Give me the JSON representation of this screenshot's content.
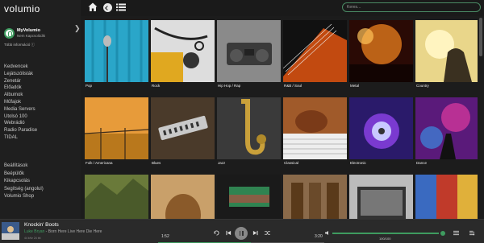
{
  "app": {
    "logo": "volumio"
  },
  "sidebar": {
    "myvolumio_title": "MyVolumio",
    "myvolumio_subtitle": "Nem Kapcsolódik",
    "more_info": "Több információ ⓘ",
    "nav": [
      "Kedvencek",
      "Lejátszólisták",
      "Zenetár",
      "Előadók",
      "Albumok",
      "Műfajok",
      "Media Servers",
      "Utolsó 100",
      "Webrádió",
      "Radio Paradise",
      "TIDAL"
    ],
    "nav2": [
      "Beállítások",
      "Beépülők",
      "Kikapcsolás",
      "Segítség (angolul)",
      "Volumio Shop"
    ]
  },
  "topbar": {
    "search_placeholder": "Keres..."
  },
  "grid": {
    "tiles": [
      {
        "label": "Pop"
      },
      {
        "label": "Rock"
      },
      {
        "label": "Hip Hop / Rap"
      },
      {
        "label": "R&B / Soul"
      },
      {
        "label": "Metal"
      },
      {
        "label": "Country"
      },
      {
        "label": "Folk / Americana"
      },
      {
        "label": "Blues"
      },
      {
        "label": "Jazz"
      },
      {
        "label": "Classical"
      },
      {
        "label": "Electronic"
      },
      {
        "label": "Dance"
      },
      {
        "label": ""
      },
      {
        "label": ""
      },
      {
        "label": ""
      },
      {
        "label": ""
      },
      {
        "label": ""
      },
      {
        "label": ""
      }
    ]
  },
  "player": {
    "title": "Knockin' Boots",
    "artist": "Luke Bryan",
    "artist_sep": " - ",
    "album": "Born Here Live Here Die Here",
    "format": "44 kHz 24 bit",
    "elapsed": "1:52",
    "total": "3:20",
    "progress_fraction": 0.56,
    "volume_text": "100/100",
    "volume_fraction": 1.0
  },
  "colors": {
    "accent": "#3e9b5f",
    "background": "#1c1c1c"
  },
  "icons": [
    "home-icon",
    "back-icon",
    "list-icon",
    "repeat-icon",
    "prev-icon",
    "next-icon",
    "shuffle-icon",
    "volume-icon",
    "queue-icon"
  ]
}
